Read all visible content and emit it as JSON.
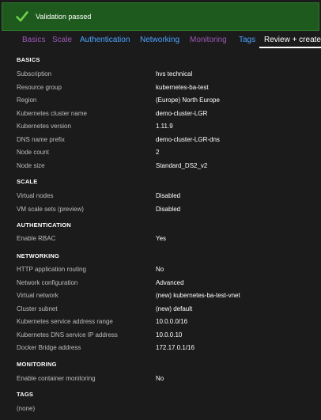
{
  "banner": {
    "text": "Validation passed",
    "color": "#1e5a1e",
    "icon": "checkmark-icon"
  },
  "tabs": [
    {
      "label": "Basics",
      "color": "#9b59b6"
    },
    {
      "label": "Scale",
      "color": "#9b59b6"
    },
    {
      "label": "Authentication",
      "color": "#4aa3ff"
    },
    {
      "label": "Networking",
      "color": "#4aa3ff"
    },
    {
      "label": "Monitoring",
      "color": "#9b59b6"
    },
    {
      "label": "Tags",
      "color": "#4aa3ff"
    },
    {
      "label": "Review + create",
      "color": "#ffffff",
      "active": true
    }
  ],
  "sections": {
    "basics": {
      "title": "BASICS",
      "rows": [
        {
          "label": "Subscription",
          "value": "hvs technical"
        },
        {
          "label": "Resource group",
          "value": "kubernetes-ba-test"
        },
        {
          "label": "Region",
          "value": "(Europe) North Europe"
        },
        {
          "label": "Kubernetes cluster name",
          "value": "demo-cluster-LGR"
        },
        {
          "label": "Kubernetes version",
          "value": "1.11.9"
        },
        {
          "label": "DNS name prefix",
          "value": "demo-cluster-LGR-dns"
        },
        {
          "label": "Node count",
          "value": "2"
        },
        {
          "label": "Node size",
          "value": "Standard_DS2_v2"
        }
      ]
    },
    "scale": {
      "title": "SCALE",
      "rows": [
        {
          "label": "Virtual nodes",
          "value": "Disabled"
        },
        {
          "label": "VM scale sets (preview)",
          "value": "Disabled"
        }
      ]
    },
    "authentication": {
      "title": "AUTHENTICATION",
      "rows": [
        {
          "label": "Enable RBAC",
          "value": "Yes"
        }
      ]
    },
    "networking": {
      "title": "NETWORKING",
      "rows": [
        {
          "label": "HTTP application routing",
          "value": "No"
        },
        {
          "label": "Network configuration",
          "value": "Advanced"
        },
        {
          "label": "Virtual network",
          "value": "(new) kubernetes-ba-test-vnet"
        },
        {
          "label": "Cluster subnet",
          "value": "(new) default"
        },
        {
          "label": "Kubernetes service address range",
          "value": "10.0.0.0/16"
        },
        {
          "label": "Kubernetes DNS service IP address",
          "value": "10.0.0.10"
        },
        {
          "label": "Docker Bridge address",
          "value": "172.17.0.1/16"
        }
      ]
    },
    "monitoring": {
      "title": "MONITORING",
      "rows": [
        {
          "label": "Enable container monitoring",
          "value": "No"
        }
      ]
    },
    "tags": {
      "title": "TAGS",
      "rows": [
        {
          "label": "(none)"
        }
      ]
    }
  }
}
